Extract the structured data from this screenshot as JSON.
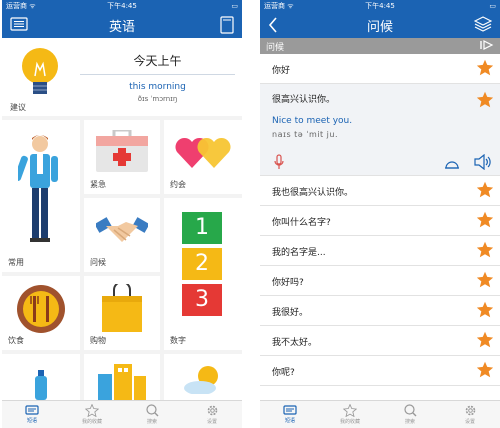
{
  "status": {
    "carrier": "运营商 ᯤ",
    "time": "下午4:45",
    "battery": "▭"
  },
  "left": {
    "title": "英语",
    "featured": {
      "label": "建议",
      "word": "今天上午",
      "translation": "this morning",
      "phonetic": "ðɪs ˈmɔrnɪŋ"
    },
    "categories": [
      {
        "label": "常用",
        "icon": "person-icon"
      },
      {
        "label": "紧急",
        "icon": "first-aid-kit-icon"
      },
      {
        "label": "约会",
        "icon": "hearts-icon"
      },
      {
        "label": "问候",
        "icon": "handshake-icon"
      },
      {
        "label": "数字",
        "icon": "numbers-icon",
        "numbers": [
          "1",
          "2",
          "3"
        ]
      },
      {
        "label": "饮食",
        "icon": "fork-knife-icon"
      },
      {
        "label": "购物",
        "icon": "shopping-bag-icon"
      }
    ],
    "tabs": [
      {
        "label": "短语",
        "icon": "chat-icon",
        "active": true
      },
      {
        "label": "我的收藏",
        "icon": "star-icon",
        "active": false
      },
      {
        "label": "搜索",
        "icon": "search-icon",
        "active": false
      },
      {
        "label": "设置",
        "icon": "gear-icon",
        "active": false
      }
    ]
  },
  "right": {
    "title": "问候",
    "section": "问候",
    "phrases": [
      "你好",
      "我也很高兴认识你。",
      "你叫什么名字?",
      "我的名字是...",
      "你好吗?",
      "我很好。",
      "我不太好。",
      "你呢?"
    ],
    "expanded": {
      "text": "很高兴认识你。",
      "translation": "Nice to meet you.",
      "phonetic": "naɪs tə ˈmit ju."
    },
    "tabs": [
      {
        "label": "短语",
        "icon": "chat-icon",
        "active": true
      },
      {
        "label": "我的收藏",
        "icon": "star-icon",
        "active": false
      },
      {
        "label": "搜索",
        "icon": "search-icon",
        "active": false
      },
      {
        "label": "设置",
        "icon": "gear-icon",
        "active": false
      }
    ]
  },
  "colors": {
    "primary": "#1b63b3",
    "star": "#f08a24",
    "mic": "#d9534f"
  }
}
